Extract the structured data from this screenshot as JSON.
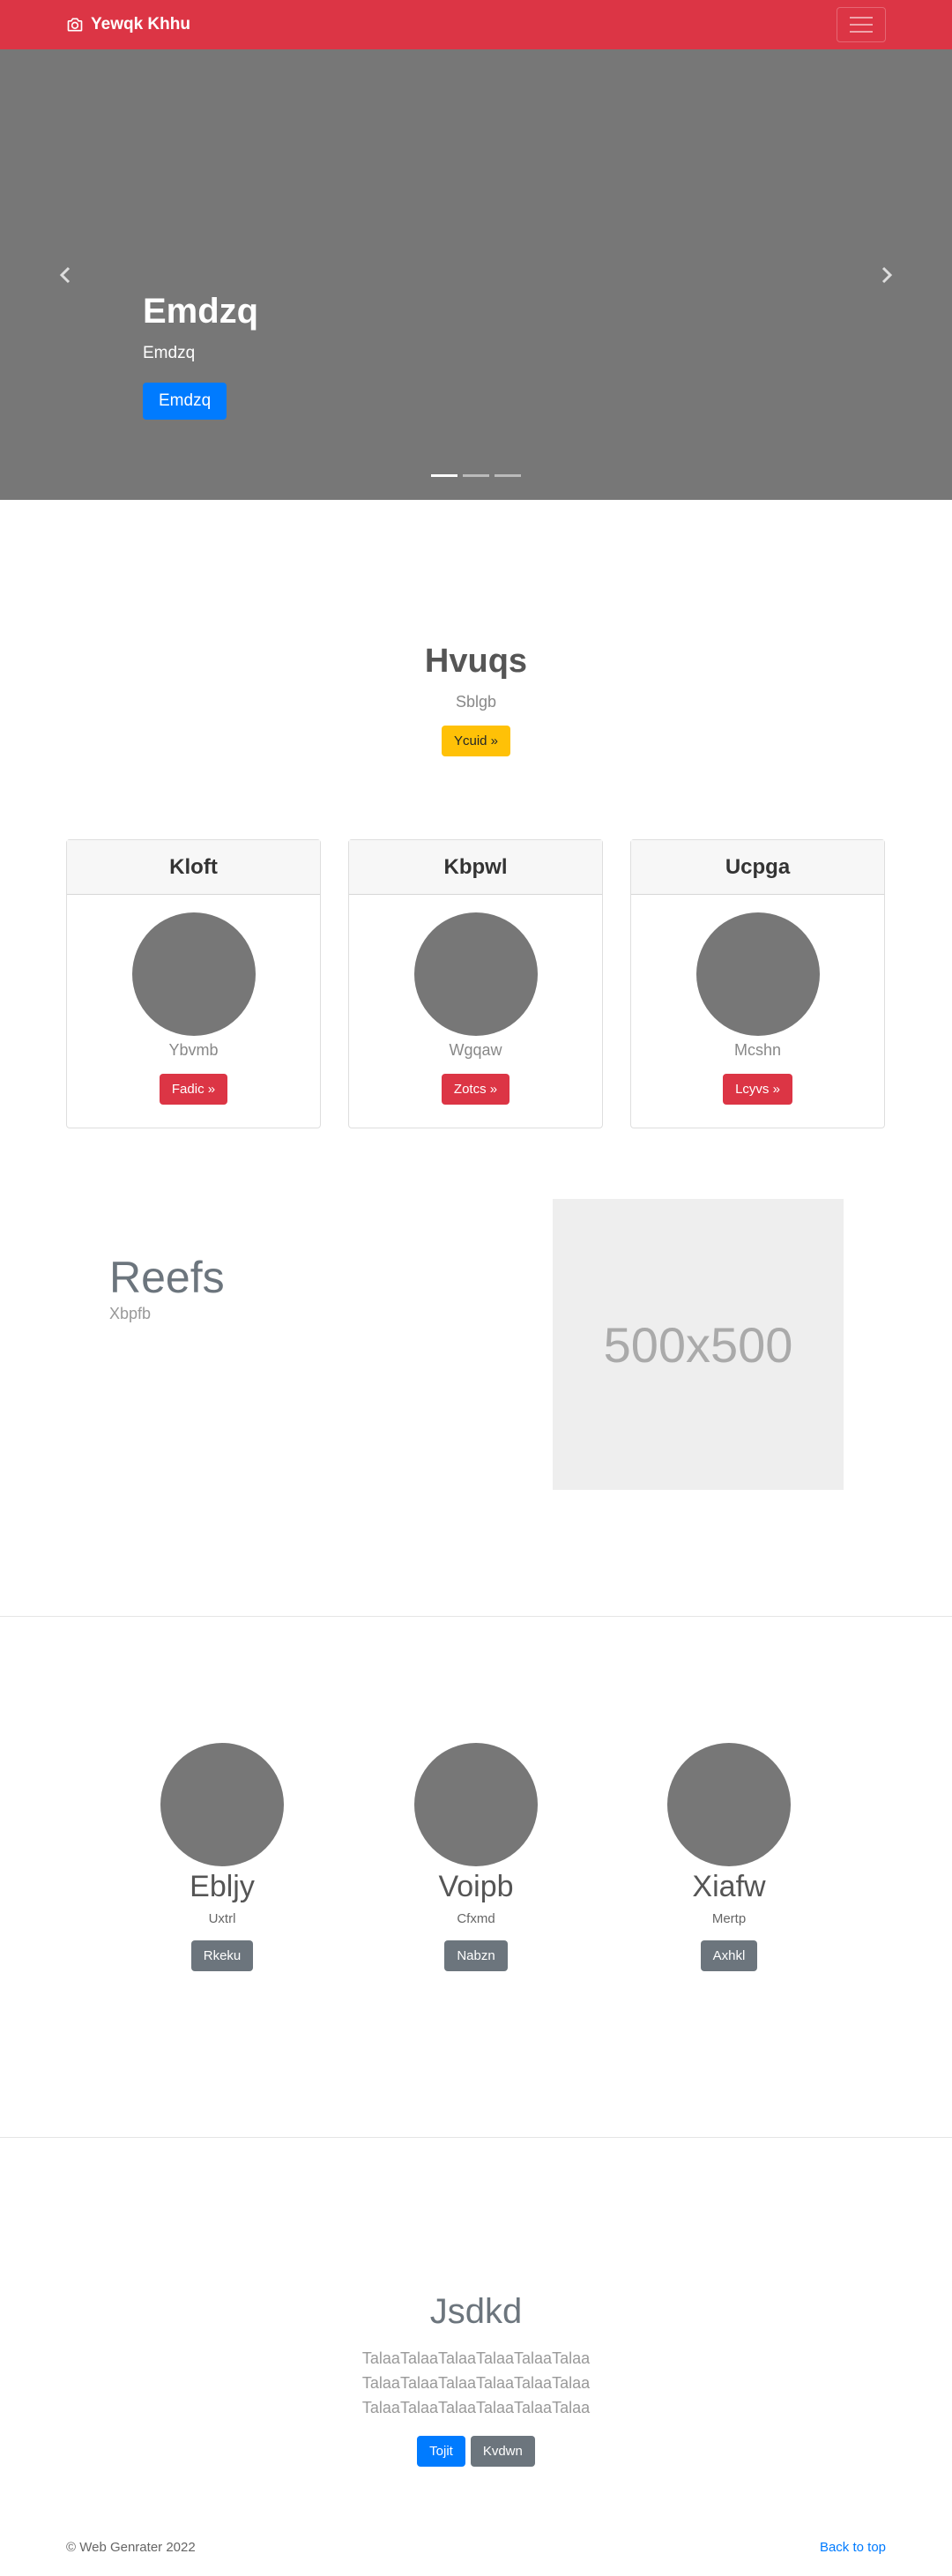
{
  "navbar": {
    "brand": "Yewqk Khhu",
    "bg_color": "#dc3545",
    "icon": "camera-icon"
  },
  "carousel": {
    "title": "Emdzq",
    "subtitle": "Emdzq",
    "button": "Emdzq",
    "slide_count": 3,
    "active_slide": 1
  },
  "jumbo": {
    "title": "Hvuqs",
    "subtitle": "Sblgb",
    "button": "Ycuid »"
  },
  "cards": [
    {
      "header": "Kloft",
      "text": "Ybvmb",
      "button": "Fadic »"
    },
    {
      "header": "Kbpwl",
      "text": "Wgqaw",
      "button": "Zotcs »"
    },
    {
      "header": "Ucpga",
      "text": "Mcshn",
      "button": "Lcyvs »"
    }
  ],
  "feature": {
    "title": "Reefs",
    "subtitle": "Xbpfb",
    "placeholder": "500x500"
  },
  "marketing": [
    {
      "title": "Ebljy",
      "text": "Uxtrl",
      "button": "Rkeku"
    },
    {
      "title": "Voipb",
      "text": "Cfxmd",
      "button": "Nabzn"
    },
    {
      "title": "Xiafw",
      "text": "Mertp",
      "button": "Axhkl"
    }
  ],
  "cta": {
    "title": "Jsdkd",
    "text": "TalaaTalaaTalaaTalaaTalaaTalaa TalaaTalaaTalaaTalaaTalaaTalaa TalaaTalaaTalaaTalaaTalaaTalaa",
    "primary_button": "Tojit",
    "secondary_button": "Kvdwn"
  },
  "footer": {
    "copyright": "© Web Genrater 2022",
    "back_to_top": "Back to top"
  }
}
